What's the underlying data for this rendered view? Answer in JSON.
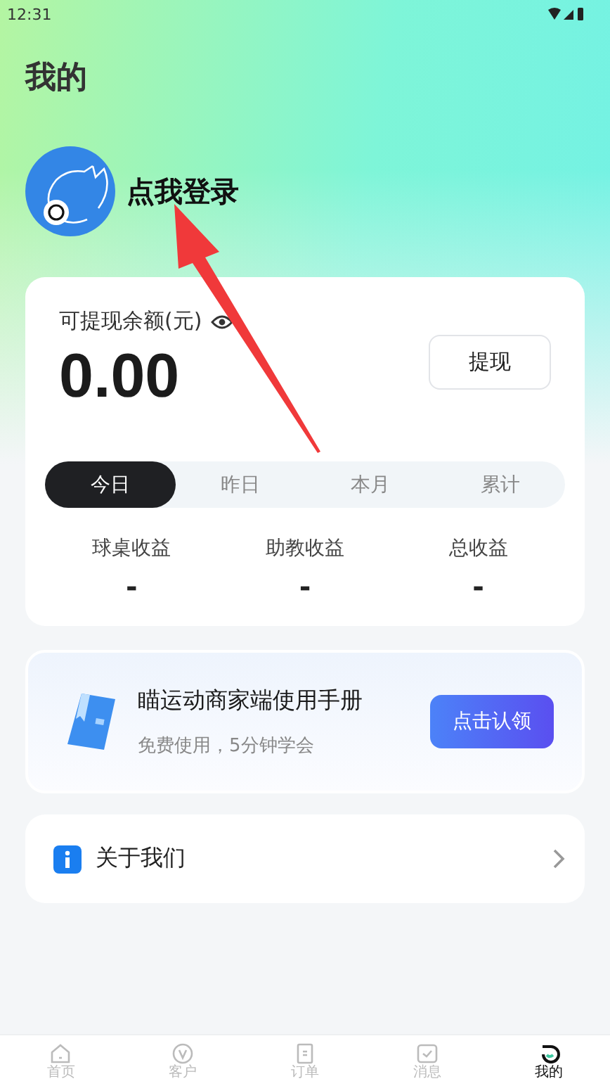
{
  "status_bar": {
    "time": "12:31"
  },
  "title": "我的",
  "profile": {
    "login_text": "点我登录"
  },
  "balance": {
    "label": "可提现余额(元)",
    "amount": "0.00",
    "withdraw_button": "提现"
  },
  "period_tabs": [
    {
      "label": "今日",
      "selected": true
    },
    {
      "label": "昨日",
      "selected": false
    },
    {
      "label": "本月",
      "selected": false
    },
    {
      "label": "累计",
      "selected": false
    }
  ],
  "stats": [
    {
      "label": "球桌收益",
      "value": "-"
    },
    {
      "label": "助教收益",
      "value": "-"
    },
    {
      "label": "总收益",
      "value": "-"
    }
  ],
  "manual": {
    "title": "瞄运动商家端使用手册",
    "subtitle": "免费使用，5分钟学会",
    "button": "点击认领"
  },
  "menu": [
    {
      "label": "关于我们"
    }
  ],
  "nav": [
    {
      "label": "首页",
      "selected": false
    },
    {
      "label": "客户",
      "selected": false
    },
    {
      "label": "订单",
      "selected": false
    },
    {
      "label": "消息",
      "selected": false
    },
    {
      "label": "我的",
      "selected": true
    }
  ]
}
